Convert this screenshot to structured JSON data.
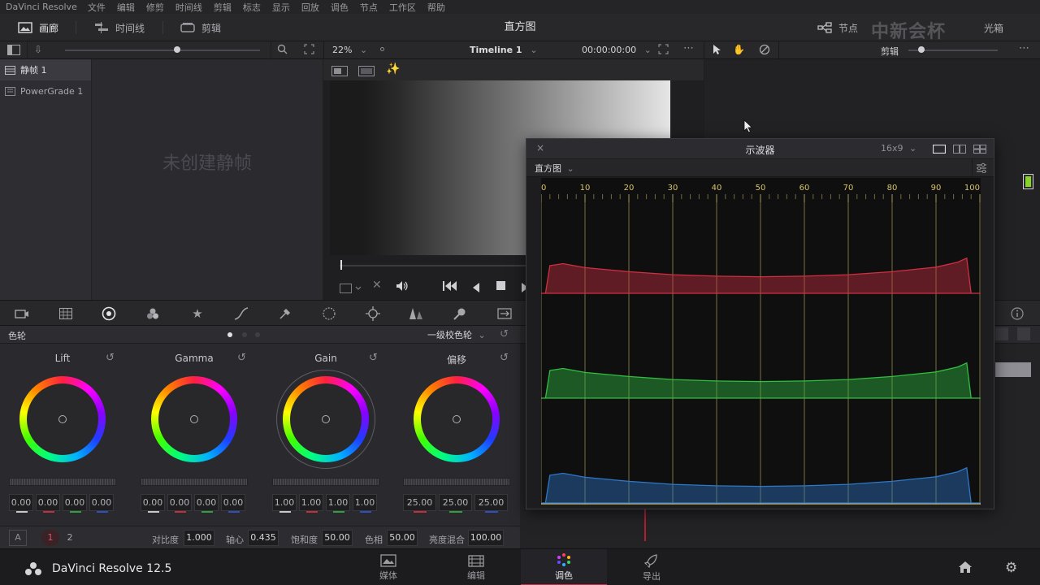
{
  "menu": {
    "app_name": "DaVinci Resolve",
    "items": [
      "文件",
      "编辑",
      "修剪",
      "时间线",
      "剪辑",
      "标志",
      "显示",
      "回放",
      "调色",
      "节点",
      "工作区",
      "帮助"
    ]
  },
  "header": {
    "gallery_label": "画廊",
    "timeline_label": "时间线",
    "clips_label": "剪辑",
    "page_title": "直方图",
    "nodes_label": "节点",
    "lightbox_label": "光箱",
    "watermark": "中新会杯"
  },
  "viewer": {
    "zoom": "22%",
    "timeline_name": "Timeline 1",
    "timecode": "00:00:00:00",
    "clip_label": "剪辑"
  },
  "gallery": {
    "items": [
      "静帧 1",
      "PowerGrade 1"
    ],
    "empty_message": "未创建静帧"
  },
  "wheels": {
    "panel_title": "色轮",
    "mode": "一级校色轮",
    "blocks": [
      {
        "title": "Lift",
        "values": [
          "0.00",
          "0.00",
          "0.00",
          "0.00"
        ]
      },
      {
        "title": "Gamma",
        "values": [
          "0.00",
          "0.00",
          "0.00",
          "0.00"
        ]
      },
      {
        "title": "Gain",
        "values": [
          "1.00",
          "1.00",
          "1.00",
          "1.00"
        ]
      },
      {
        "title": "偏移",
        "values": [
          "25.00",
          "25.00",
          "25.00"
        ]
      }
    ],
    "footer": {
      "auto_label": "A",
      "page_1": "1",
      "page_2": "2",
      "contrast_label": "对比度",
      "contrast": "1.000",
      "pivot_label": "轴心",
      "pivot": "0.435",
      "saturation_label": "饱和度",
      "saturation": "50.00",
      "hue_label": "色相",
      "hue": "50.00",
      "lum_mix_label": "亮度混合",
      "lum_mix": "100.00"
    }
  },
  "scope": {
    "title": "示波器",
    "aspect": "16x9",
    "mode": "直方图",
    "ticks": [
      "0",
      "10",
      "20",
      "30",
      "40",
      "50",
      "60",
      "70",
      "80",
      "90",
      "100"
    ]
  },
  "chart_data": {
    "type": "area",
    "x": [
      0,
      1,
      2,
      5,
      10,
      20,
      30,
      40,
      50,
      60,
      70,
      80,
      90,
      95,
      97,
      98,
      100
    ],
    "series": [
      {
        "channel": "red",
        "color": "#d03040",
        "values": [
          0,
          0,
          0.55,
          0.59,
          0.51,
          0.43,
          0.37,
          0.34,
          0.33,
          0.34,
          0.37,
          0.43,
          0.52,
          0.62,
          0.7,
          0,
          0
        ]
      },
      {
        "channel": "green",
        "color": "#30c040",
        "values": [
          0,
          0,
          0.55,
          0.59,
          0.51,
          0.43,
          0.37,
          0.34,
          0.33,
          0.34,
          0.37,
          0.43,
          0.52,
          0.62,
          0.7,
          0,
          0
        ]
      },
      {
        "channel": "blue",
        "color": "#2e78c8",
        "values": [
          0,
          0,
          0.55,
          0.59,
          0.51,
          0.43,
          0.37,
          0.34,
          0.33,
          0.34,
          0.37,
          0.43,
          0.52,
          0.62,
          0.7,
          0,
          0
        ]
      }
    ],
    "xlim": [
      0,
      100
    ],
    "grid": true
  },
  "bottom": {
    "product": "DaVinci Resolve 12.5",
    "tabs": [
      {
        "label": "媒体"
      },
      {
        "label": "编辑"
      },
      {
        "label": "调色"
      },
      {
        "label": "导出"
      }
    ]
  },
  "colors": {
    "accent": "#c0304a",
    "scope_grid": "#d6c46a"
  }
}
